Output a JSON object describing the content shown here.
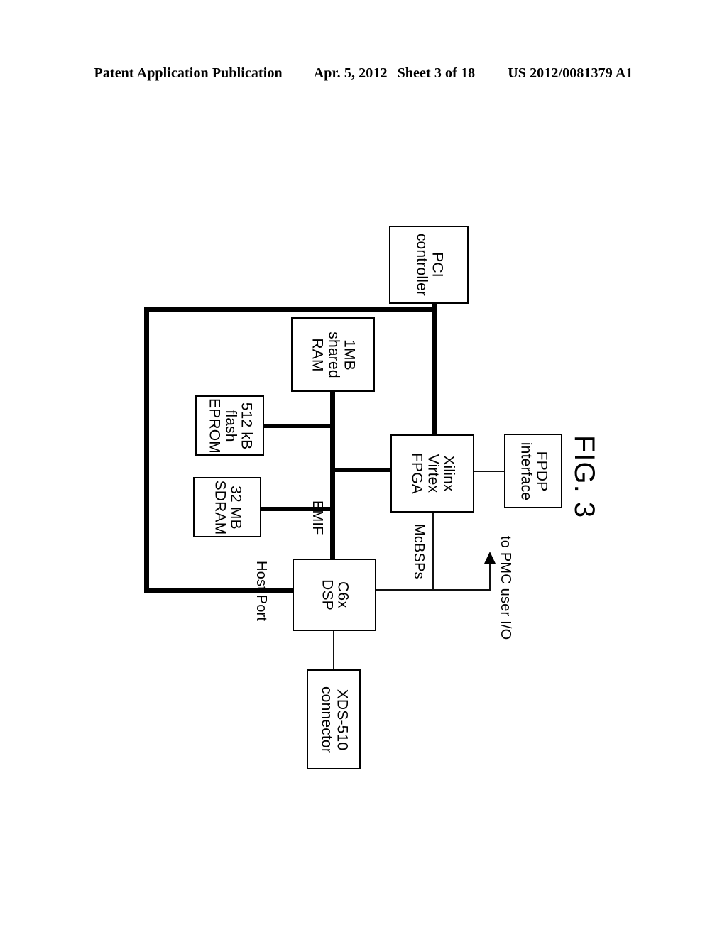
{
  "header": {
    "publication": "Patent Application Publication",
    "date": "Apr. 5, 2012",
    "sheet": "Sheet 3 of 18",
    "patent_number": "US 2012/0081379 A1"
  },
  "figure": {
    "label": "FIG. 3",
    "nodes": {
      "pci_controller": "PCI\ncontroller",
      "shared_ram": "1MB\nshared\nRAM",
      "flash_eprom": "512 kB\nflash\nEPROM",
      "sdram": "32 MB\nSDRAM",
      "fpga": "Xilinx\nVirtex\nFPGA",
      "fpdp_interface": "FPDP\ninterface",
      "dsp": "C6x\nDSP",
      "xds_connector": "XDS-510\nconnector"
    },
    "bus_labels": {
      "emif": "EMIF",
      "host_port": "Host Port",
      "mcbsps": "McBSPs",
      "pmc_user_io": "to PMC user I/O"
    },
    "colors": {
      "line": "#000000",
      "box_border": "#000000",
      "background": "#ffffff"
    }
  }
}
